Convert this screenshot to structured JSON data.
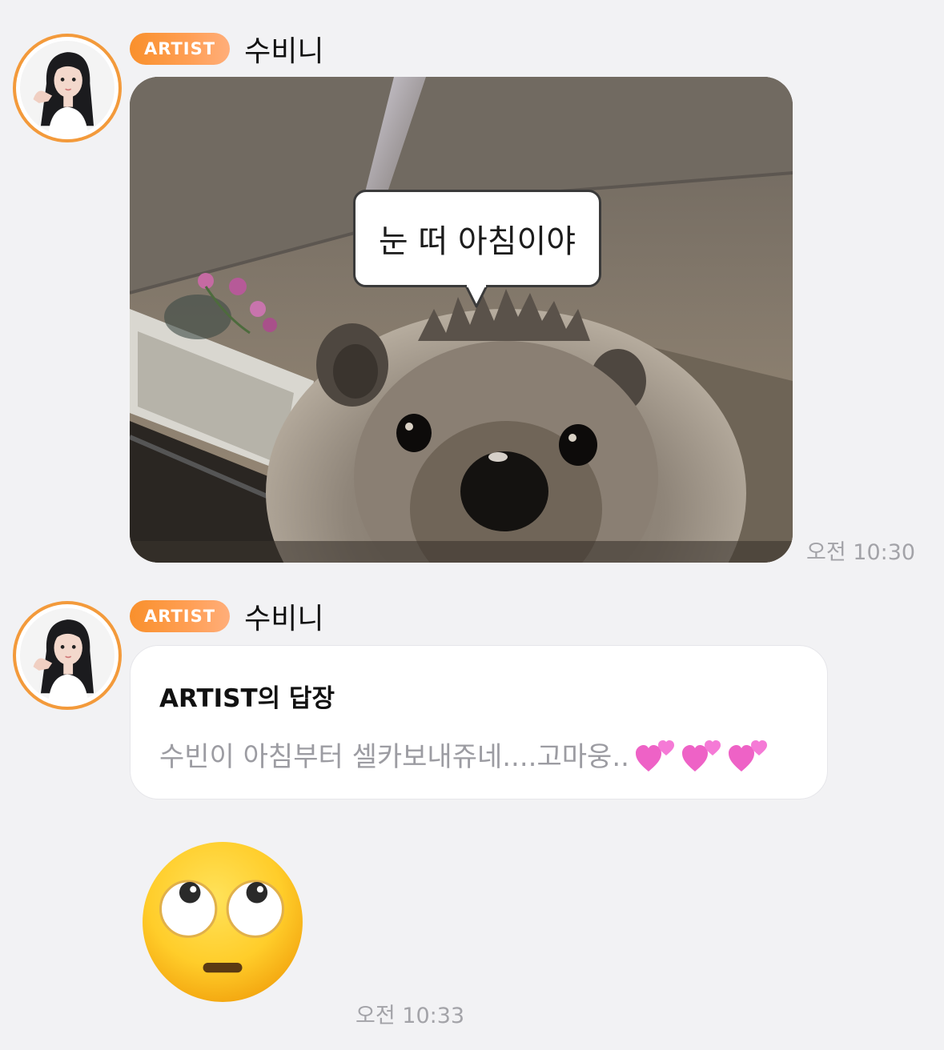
{
  "messages": [
    {
      "badge": "ARTIST",
      "sender": "수비니",
      "image_caption": "눈 떠 아침이야",
      "timestamp": "오전 10:30"
    },
    {
      "badge": "ARTIST",
      "sender": "수비니",
      "reply_title": "ARTIST의 답장",
      "reply_text": "수빈이 아침부터 셀카보내쥬네....고마웅..",
      "reply_emojis": [
        "two-hearts-icon",
        "two-hearts-icon",
        "two-hearts-icon"
      ]
    },
    {
      "emoji": "face-with-rolling-eyes-icon",
      "timestamp": "오전 10:33"
    }
  ],
  "colors": {
    "background": "#f2f2f4",
    "badge": "#f9902c",
    "avatar_ring": "#f39a3b",
    "timestamp": "#a3a3a8",
    "reply_text": "#9c9ca2"
  }
}
